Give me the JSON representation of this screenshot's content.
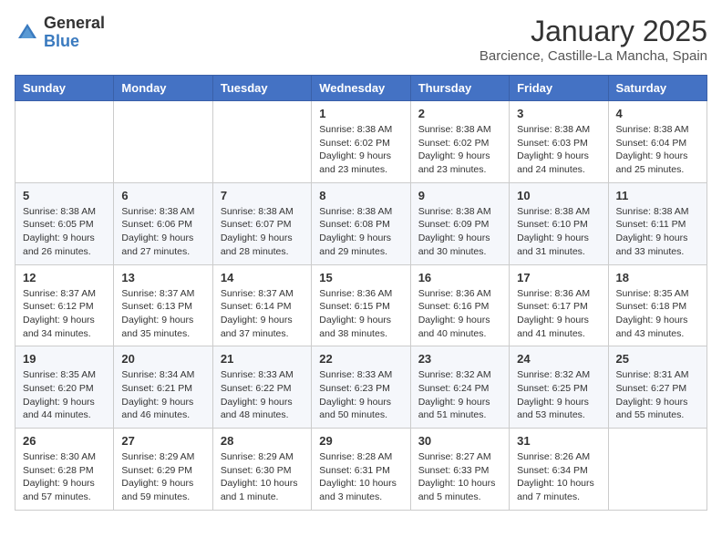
{
  "header": {
    "logo_general": "General",
    "logo_blue": "Blue",
    "month_title": "January 2025",
    "location": "Barcience, Castille-La Mancha, Spain"
  },
  "weekdays": [
    "Sunday",
    "Monday",
    "Tuesday",
    "Wednesday",
    "Thursday",
    "Friday",
    "Saturday"
  ],
  "weeks": [
    [
      {
        "day": "",
        "detail": ""
      },
      {
        "day": "",
        "detail": ""
      },
      {
        "day": "",
        "detail": ""
      },
      {
        "day": "1",
        "detail": "Sunrise: 8:38 AM\nSunset: 6:02 PM\nDaylight: 9 hours\nand 23 minutes."
      },
      {
        "day": "2",
        "detail": "Sunrise: 8:38 AM\nSunset: 6:02 PM\nDaylight: 9 hours\nand 23 minutes."
      },
      {
        "day": "3",
        "detail": "Sunrise: 8:38 AM\nSunset: 6:03 PM\nDaylight: 9 hours\nand 24 minutes."
      },
      {
        "day": "4",
        "detail": "Sunrise: 8:38 AM\nSunset: 6:04 PM\nDaylight: 9 hours\nand 25 minutes."
      }
    ],
    [
      {
        "day": "5",
        "detail": "Sunrise: 8:38 AM\nSunset: 6:05 PM\nDaylight: 9 hours\nand 26 minutes."
      },
      {
        "day": "6",
        "detail": "Sunrise: 8:38 AM\nSunset: 6:06 PM\nDaylight: 9 hours\nand 27 minutes."
      },
      {
        "day": "7",
        "detail": "Sunrise: 8:38 AM\nSunset: 6:07 PM\nDaylight: 9 hours\nand 28 minutes."
      },
      {
        "day": "8",
        "detail": "Sunrise: 8:38 AM\nSunset: 6:08 PM\nDaylight: 9 hours\nand 29 minutes."
      },
      {
        "day": "9",
        "detail": "Sunrise: 8:38 AM\nSunset: 6:09 PM\nDaylight: 9 hours\nand 30 minutes."
      },
      {
        "day": "10",
        "detail": "Sunrise: 8:38 AM\nSunset: 6:10 PM\nDaylight: 9 hours\nand 31 minutes."
      },
      {
        "day": "11",
        "detail": "Sunrise: 8:38 AM\nSunset: 6:11 PM\nDaylight: 9 hours\nand 33 minutes."
      }
    ],
    [
      {
        "day": "12",
        "detail": "Sunrise: 8:37 AM\nSunset: 6:12 PM\nDaylight: 9 hours\nand 34 minutes."
      },
      {
        "day": "13",
        "detail": "Sunrise: 8:37 AM\nSunset: 6:13 PM\nDaylight: 9 hours\nand 35 minutes."
      },
      {
        "day": "14",
        "detail": "Sunrise: 8:37 AM\nSunset: 6:14 PM\nDaylight: 9 hours\nand 37 minutes."
      },
      {
        "day": "15",
        "detail": "Sunrise: 8:36 AM\nSunset: 6:15 PM\nDaylight: 9 hours\nand 38 minutes."
      },
      {
        "day": "16",
        "detail": "Sunrise: 8:36 AM\nSunset: 6:16 PM\nDaylight: 9 hours\nand 40 minutes."
      },
      {
        "day": "17",
        "detail": "Sunrise: 8:36 AM\nSunset: 6:17 PM\nDaylight: 9 hours\nand 41 minutes."
      },
      {
        "day": "18",
        "detail": "Sunrise: 8:35 AM\nSunset: 6:18 PM\nDaylight: 9 hours\nand 43 minutes."
      }
    ],
    [
      {
        "day": "19",
        "detail": "Sunrise: 8:35 AM\nSunset: 6:20 PM\nDaylight: 9 hours\nand 44 minutes."
      },
      {
        "day": "20",
        "detail": "Sunrise: 8:34 AM\nSunset: 6:21 PM\nDaylight: 9 hours\nand 46 minutes."
      },
      {
        "day": "21",
        "detail": "Sunrise: 8:33 AM\nSunset: 6:22 PM\nDaylight: 9 hours\nand 48 minutes."
      },
      {
        "day": "22",
        "detail": "Sunrise: 8:33 AM\nSunset: 6:23 PM\nDaylight: 9 hours\nand 50 minutes."
      },
      {
        "day": "23",
        "detail": "Sunrise: 8:32 AM\nSunset: 6:24 PM\nDaylight: 9 hours\nand 51 minutes."
      },
      {
        "day": "24",
        "detail": "Sunrise: 8:32 AM\nSunset: 6:25 PM\nDaylight: 9 hours\nand 53 minutes."
      },
      {
        "day": "25",
        "detail": "Sunrise: 8:31 AM\nSunset: 6:27 PM\nDaylight: 9 hours\nand 55 minutes."
      }
    ],
    [
      {
        "day": "26",
        "detail": "Sunrise: 8:30 AM\nSunset: 6:28 PM\nDaylight: 9 hours\nand 57 minutes."
      },
      {
        "day": "27",
        "detail": "Sunrise: 8:29 AM\nSunset: 6:29 PM\nDaylight: 9 hours\nand 59 minutes."
      },
      {
        "day": "28",
        "detail": "Sunrise: 8:29 AM\nSunset: 6:30 PM\nDaylight: 10 hours\nand 1 minute."
      },
      {
        "day": "29",
        "detail": "Sunrise: 8:28 AM\nSunset: 6:31 PM\nDaylight: 10 hours\nand 3 minutes."
      },
      {
        "day": "30",
        "detail": "Sunrise: 8:27 AM\nSunset: 6:33 PM\nDaylight: 10 hours\nand 5 minutes."
      },
      {
        "day": "31",
        "detail": "Sunrise: 8:26 AM\nSunset: 6:34 PM\nDaylight: 10 hours\nand 7 minutes."
      },
      {
        "day": "",
        "detail": ""
      }
    ]
  ]
}
